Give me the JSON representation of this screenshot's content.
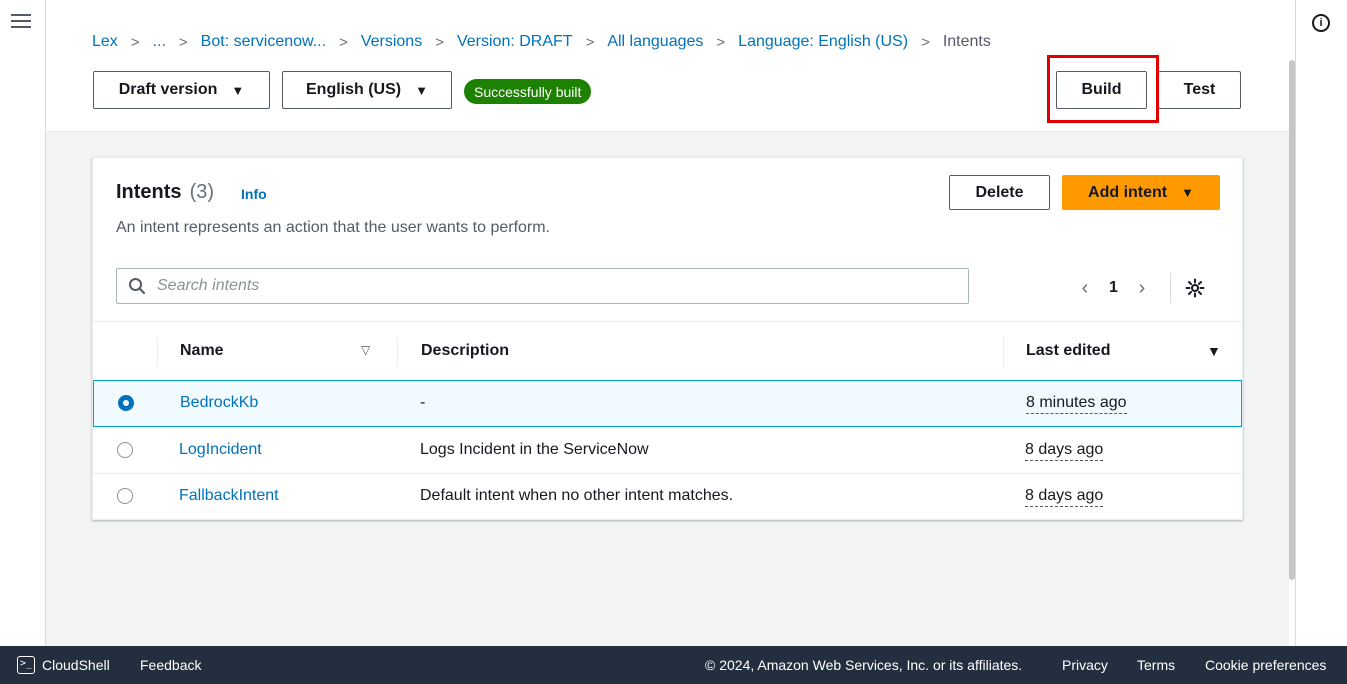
{
  "breadcrumb": {
    "items": [
      "Lex",
      "...",
      "Bot: servicenow...",
      "Versions",
      "Version: DRAFT",
      "All languages",
      "Language: English (US)",
      "Intents"
    ],
    "separator": ">"
  },
  "toolbar": {
    "version_select": "Draft version",
    "language_select": "English (US)",
    "build_status": "Successfully built",
    "build_label": "Build",
    "test_label": "Test"
  },
  "panel": {
    "title": "Intents",
    "count": "(3)",
    "info_label": "Info",
    "description": "An intent represents an action that the user wants to perform.",
    "delete_label": "Delete",
    "add_intent_label": "Add intent",
    "search_placeholder": "Search intents",
    "page_number": "1",
    "columns": {
      "name": "Name",
      "description": "Description",
      "last_edited": "Last edited"
    },
    "rows": [
      {
        "name": "BedrockKb",
        "description": "-",
        "last_edited": "8 minutes ago",
        "selected": true
      },
      {
        "name": "LogIncident",
        "description": "Logs Incident in the ServiceNow",
        "last_edited": "8 days ago",
        "selected": false
      },
      {
        "name": "FallbackIntent",
        "description": "Default intent when no other intent matches.",
        "last_edited": "8 days ago",
        "selected": false
      }
    ]
  },
  "footer": {
    "cloudshell": "CloudShell",
    "feedback": "Feedback",
    "copyright": "© 2024, Amazon Web Services, Inc. or its affiliates.",
    "privacy": "Privacy",
    "terms": "Terms",
    "cookies": "Cookie preferences"
  },
  "colors": {
    "link": "#0073bb",
    "success": "#1d8102",
    "primary": "#ff9900",
    "highlight": "#e00000",
    "footer_bg": "#232f3e"
  },
  "icons": [
    "menu-icon",
    "info-icon",
    "search-icon",
    "chevron-left-icon",
    "chevron-right-icon",
    "settings-gear-icon",
    "sort-icon",
    "caret-down-icon",
    "cloudshell-icon"
  ]
}
